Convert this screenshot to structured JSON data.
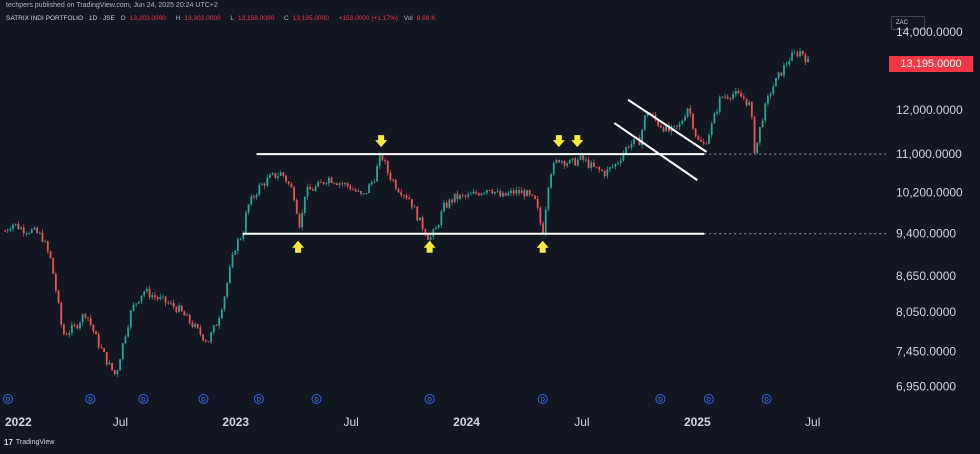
{
  "header": {
    "publisher": "techpers published on TradingView.com, Jun 24, 2025 20:24 UTC+2",
    "symbol": "SATRIX INDI PORTFOLIO · 1D · JSE",
    "open_label": "O",
    "open": "13,203.0000",
    "high_label": "H",
    "high": "13,302.0000",
    "low_label": "L",
    "low": "13,158.0000",
    "close_label": "C",
    "close": "13,195.0000",
    "change": "+153.0000 (+1.17%)",
    "vol_label": "Vol",
    "vol": "8.98 K",
    "currency": "ZAC"
  },
  "footer": {
    "logo": "17",
    "brand": "TradingView"
  },
  "colors": {
    "background": "#131722",
    "up": "#26a69a",
    "down": "#ef5350",
    "arrow": "#ffeb3b",
    "last_price_bg": "#f23645",
    "line": "#ffffff"
  },
  "last_price_label": "13,195.0000",
  "chart_data": {
    "type": "candlestick",
    "y_scale": "log",
    "ylim": [
      6700,
      14200
    ],
    "y_ticks": [
      {
        "value": 14000,
        "label": "14,000.0000"
      },
      {
        "value": 13195,
        "label": "13,195.0000"
      },
      {
        "value": 12000,
        "label": "12,000.0000"
      },
      {
        "value": 11000,
        "label": "11,000.0000"
      },
      {
        "value": 10200,
        "label": "10,200.0000"
      },
      {
        "value": 9400,
        "label": "9,400.0000"
      },
      {
        "value": 8650,
        "label": "8,650.0000"
      },
      {
        "value": 8050,
        "label": "8,050.0000"
      },
      {
        "value": 7450,
        "label": "7,450.0000"
      },
      {
        "value": 6950,
        "label": "6,950.0000"
      }
    ],
    "x_ticks": [
      {
        "t": 0.0,
        "label": "2022"
      },
      {
        "t": 0.5,
        "label": "Jul"
      },
      {
        "t": 1.0,
        "label": "2023"
      },
      {
        "t": 1.5,
        "label": "Jul"
      },
      {
        "t": 2.0,
        "label": "2024"
      },
      {
        "t": 2.5,
        "label": "Jul"
      },
      {
        "t": 3.0,
        "label": "2025"
      },
      {
        "t": 3.5,
        "label": "Jul"
      }
    ],
    "xlim": [
      0.0,
      3.64
    ],
    "price_path": [
      [
        0.0,
        9450
      ],
      [
        0.03,
        9600
      ],
      [
        0.07,
        9500
      ],
      [
        0.12,
        9450
      ],
      [
        0.16,
        9350
      ],
      [
        0.2,
        8900
      ],
      [
        0.25,
        7700
      ],
      [
        0.3,
        7800
      ],
      [
        0.35,
        8050
      ],
      [
        0.4,
        7600
      ],
      [
        0.45,
        7250
      ],
      [
        0.48,
        7100
      ],
      [
        0.52,
        7700
      ],
      [
        0.55,
        8100
      ],
      [
        0.6,
        8400
      ],
      [
        0.65,
        8300
      ],
      [
        0.7,
        8200
      ],
      [
        0.75,
        8100
      ],
      [
        0.8,
        7900
      ],
      [
        0.85,
        7700
      ],
      [
        0.88,
        7600
      ],
      [
        0.92,
        7900
      ],
      [
        0.95,
        8300
      ],
      [
        1.0,
        9200
      ],
      [
        1.03,
        9400
      ],
      [
        1.05,
        9900
      ],
      [
        1.1,
        10300
      ],
      [
        1.15,
        10500
      ],
      [
        1.2,
        10600
      ],
      [
        1.25,
        10200
      ],
      [
        1.28,
        9500
      ],
      [
        1.3,
        10200
      ],
      [
        1.35,
        10300
      ],
      [
        1.4,
        10500
      ],
      [
        1.45,
        10400
      ],
      [
        1.5,
        10300
      ],
      [
        1.55,
        10100
      ],
      [
        1.6,
        10500
      ],
      [
        1.63,
        11000
      ],
      [
        1.66,
        10600
      ],
      [
        1.7,
        10300
      ],
      [
        1.75,
        10100
      ],
      [
        1.8,
        9600
      ],
      [
        1.84,
        9300
      ],
      [
        1.87,
        9500
      ],
      [
        1.9,
        9900
      ],
      [
        1.95,
        10100
      ],
      [
        2.0,
        10100
      ],
      [
        2.05,
        10200
      ],
      [
        2.1,
        10300
      ],
      [
        2.15,
        10100
      ],
      [
        2.2,
        10200
      ],
      [
        2.25,
        10200
      ],
      [
        2.3,
        10000
      ],
      [
        2.33,
        9400
      ],
      [
        2.36,
        10600
      ],
      [
        2.4,
        10900
      ],
      [
        2.45,
        10800
      ],
      [
        2.5,
        10900
      ],
      [
        2.55,
        10700
      ],
      [
        2.6,
        10600
      ],
      [
        2.65,
        10800
      ],
      [
        2.7,
        11200
      ],
      [
        2.75,
        11300
      ],
      [
        2.78,
        12000
      ],
      [
        2.83,
        11700
      ],
      [
        2.88,
        11500
      ],
      [
        2.92,
        11600
      ],
      [
        2.96,
        12100
      ],
      [
        3.0,
        11300
      ],
      [
        3.03,
        11200
      ],
      [
        3.06,
        11600
      ],
      [
        3.1,
        12300
      ],
      [
        3.15,
        12400
      ],
      [
        3.2,
        12300
      ],
      [
        3.23,
        12100
      ],
      [
        3.25,
        11000
      ],
      [
        3.28,
        11800
      ],
      [
        3.32,
        12500
      ],
      [
        3.35,
        12800
      ],
      [
        3.4,
        13300
      ],
      [
        3.45,
        13500
      ],
      [
        3.48,
        13195
      ]
    ],
    "levels": [
      {
        "price": 11000,
        "t_start": 1.09,
        "t_end": 3.03,
        "extend_dashed": true
      },
      {
        "price": 9400,
        "t_start": 1.03,
        "t_end": 3.03,
        "extend_dashed": true
      }
    ],
    "channel_lines": [
      {
        "t1": 2.7,
        "p1": 12250,
        "t2": 3.04,
        "p2": 11050
      },
      {
        "t1": 2.64,
        "p1": 11700,
        "t2": 3.0,
        "p2": 10450
      }
    ],
    "arrows": [
      {
        "t": 1.27,
        "price": 9400,
        "dir": "up"
      },
      {
        "t": 1.63,
        "price": 11000,
        "dir": "down"
      },
      {
        "t": 1.84,
        "price": 9400,
        "dir": "up"
      },
      {
        "t": 2.33,
        "price": 9400,
        "dir": "up"
      },
      {
        "t": 2.4,
        "price": 11000,
        "dir": "down"
      },
      {
        "t": 2.48,
        "price": 11000,
        "dir": "down"
      }
    ],
    "dividend_markers": [
      0.0,
      0.37,
      0.6,
      0.86,
      1.1,
      1.35,
      1.84,
      2.33,
      2.84,
      3.05,
      3.3
    ]
  }
}
